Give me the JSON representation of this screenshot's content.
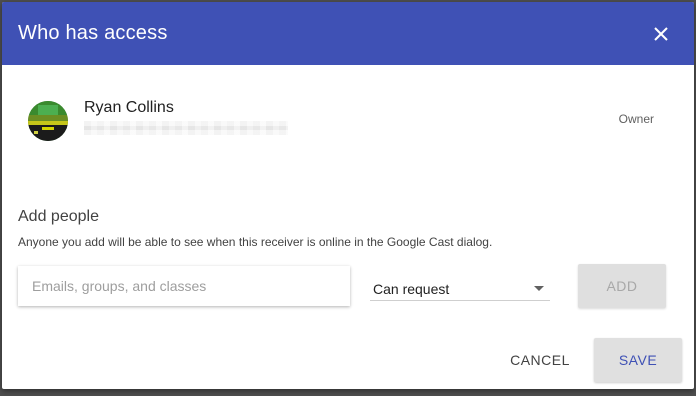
{
  "dialog": {
    "title": "Who has access",
    "header_color": "#3f51b5"
  },
  "owner": {
    "name": "Ryan Collins",
    "role": "Owner"
  },
  "add_people": {
    "title": "Add people",
    "description": "Anyone you add will be able to see when this receiver is online in the Google Cast dialog.",
    "input_placeholder": "Emails, groups, and classes",
    "input_value": "",
    "permission_selected": "Can request",
    "add_label": "ADD"
  },
  "footer": {
    "cancel_label": "CANCEL",
    "save_label": "SAVE"
  },
  "icons": {
    "close": "close-icon",
    "dropdown": "dropdown-arrow-icon"
  }
}
